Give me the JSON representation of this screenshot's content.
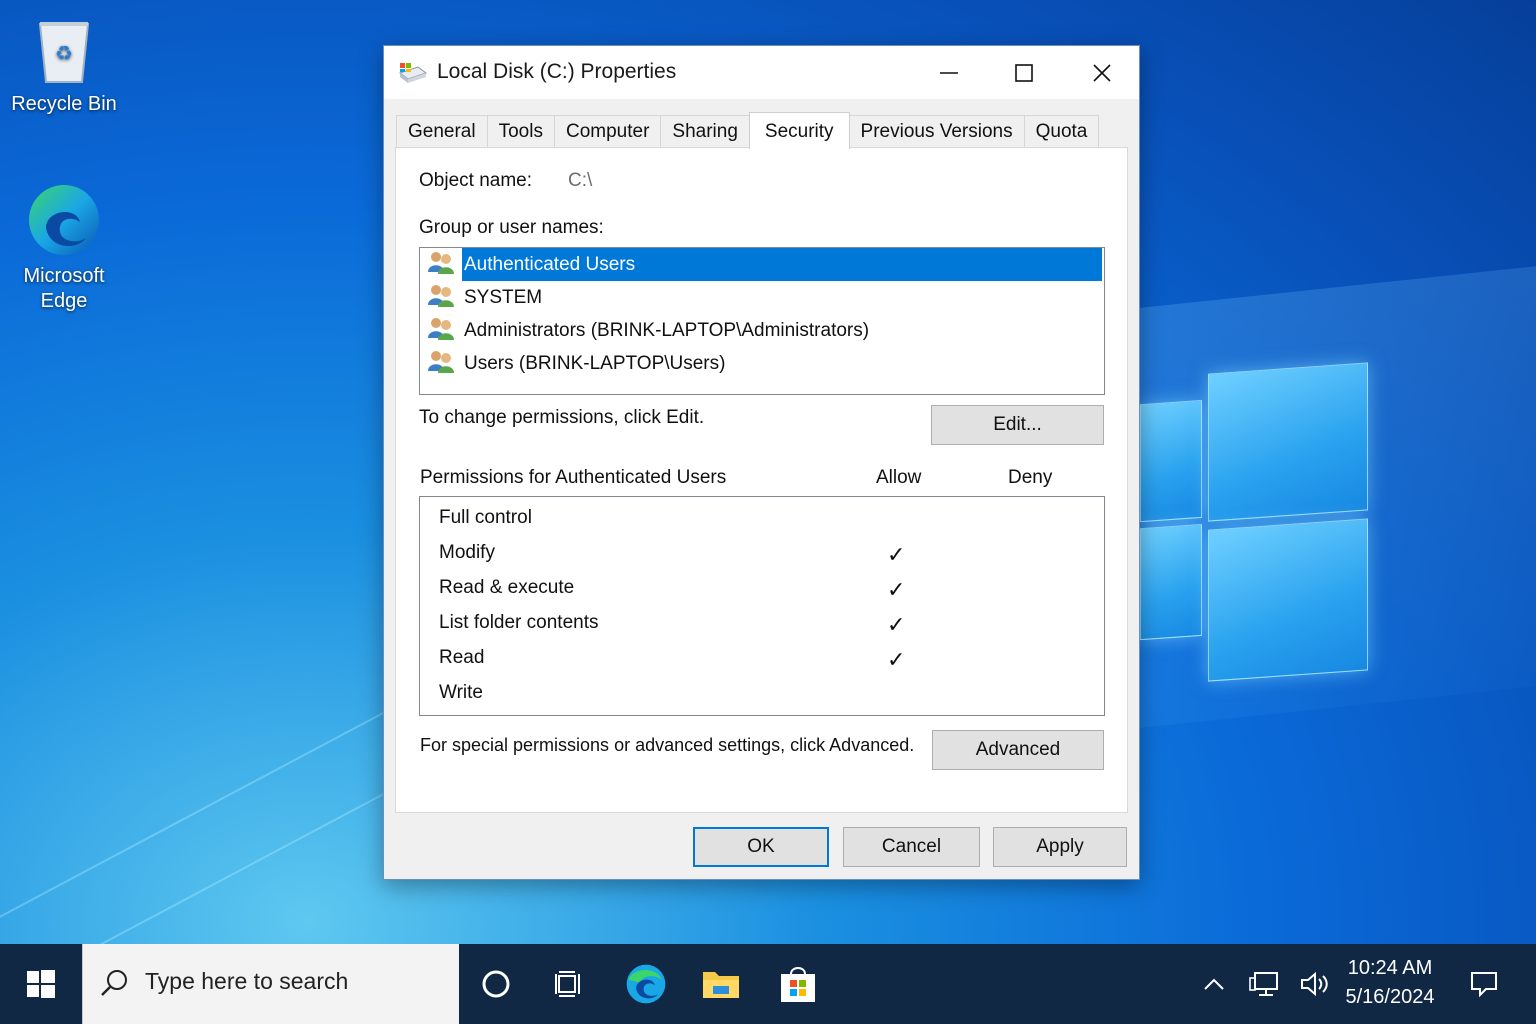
{
  "desktop": {
    "icons": [
      {
        "label": "Recycle Bin"
      },
      {
        "label_line1": "Microsoft",
        "label_line2": "Edge"
      }
    ]
  },
  "dialog": {
    "title": "Local Disk (C:) Properties",
    "tabs": [
      "General",
      "Tools",
      "Computer",
      "Sharing",
      "Security",
      "Previous Versions",
      "Quota"
    ],
    "active_tab": "Security",
    "object_name_label": "Object name:",
    "object_name_value": "C:\\",
    "group_label": "Group or user names:",
    "users": [
      {
        "name": "Authenticated Users",
        "selected": true
      },
      {
        "name": "SYSTEM",
        "selected": false
      },
      {
        "name": "Administrators (BRINK-LAPTOP\\Administrators)",
        "selected": false
      },
      {
        "name": "Users (BRINK-LAPTOP\\Users)",
        "selected": false
      }
    ],
    "change_hint": "To change permissions, click Edit.",
    "edit_button": "Edit...",
    "permissions_label": "Permissions for Authenticated Users",
    "allow_header": "Allow",
    "deny_header": "Deny",
    "permissions": [
      {
        "name": "Full control",
        "allow": "",
        "deny": ""
      },
      {
        "name": "Modify",
        "allow": "✓",
        "deny": ""
      },
      {
        "name": "Read & execute",
        "allow": "✓",
        "deny": ""
      },
      {
        "name": "List folder contents",
        "allow": "✓",
        "deny": ""
      },
      {
        "name": "Read",
        "allow": "✓",
        "deny": ""
      },
      {
        "name": "Write",
        "allow": "",
        "deny": ""
      }
    ],
    "advanced_hint": "For special permissions or advanced settings, click Advanced.",
    "advanced_button": "Advanced",
    "ok_button": "OK",
    "cancel_button": "Cancel",
    "apply_button": "Apply"
  },
  "taskbar": {
    "search_placeholder": "Type here to search",
    "time": "10:24 AM",
    "date": "5/16/2024"
  },
  "colors": {
    "selection": "#0078d7",
    "taskbar": "#102844",
    "desktop": "#0a6ad8"
  }
}
